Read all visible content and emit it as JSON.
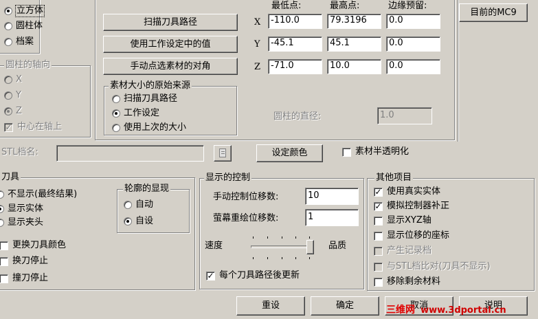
{
  "shape_group": {
    "options": [
      {
        "label": "立方体",
        "selected": true
      },
      {
        "label": "圆柱体",
        "selected": false
      },
      {
        "label": "档案",
        "selected": false
      }
    ]
  },
  "cylinder_axis": {
    "title": "圆柱的轴向",
    "options": [
      {
        "label": "X",
        "selected": false
      },
      {
        "label": "Y",
        "selected": false
      },
      {
        "label": "Z",
        "selected": true
      }
    ],
    "center_on_axis": {
      "label": "中心在轴上",
      "checked": true
    }
  },
  "bounds": {
    "buttons": {
      "scan_toolpath": "扫描刀具路径",
      "use_work_settings": "使用工作设定中的值",
      "pick_corners": "手动点选素材的对角"
    },
    "headers": {
      "min": "最低点:",
      "max": "最高点:",
      "margin": "边缘预留:"
    },
    "rows": [
      {
        "axis": "X",
        "min": "-110.0",
        "max": "79.3196",
        "margin": "0.0"
      },
      {
        "axis": "Y",
        "min": "-45.1",
        "max": "45.1",
        "margin": "0.0"
      },
      {
        "axis": "Z",
        "min": "-71.0",
        "max": "10.0",
        "margin": "0.0"
      }
    ],
    "cylinder_diameter_label": "圆柱的直径:",
    "cylinder_diameter_value": "1.0"
  },
  "source_group": {
    "title": "素材大小的原始来源",
    "options": [
      {
        "label": "扫描刀具路径",
        "selected": false
      },
      {
        "label": "工作设定",
        "selected": true
      },
      {
        "label": "使用上次的大小",
        "selected": false
      }
    ]
  },
  "current_mc9_button": "目前的MC9",
  "stl": {
    "label": "STL档名:",
    "value": "",
    "browse_icon": "browse-icon"
  },
  "set_color_button": "设定颜色",
  "translucent": {
    "label": "素材半透明化",
    "checked": false
  },
  "tool_group": {
    "title": "刀具",
    "display_options": [
      {
        "label": "不显示(最终结果)",
        "selected": false
      },
      {
        "label": "显示实体",
        "selected": true
      },
      {
        "label": "显示夹头",
        "selected": false
      }
    ],
    "checks": [
      {
        "label": "更换刀具颜色",
        "checked": false
      },
      {
        "label": "换刀停止",
        "checked": false
      },
      {
        "label": "撞刀停止",
        "checked": false
      }
    ]
  },
  "outline_group": {
    "title": "轮廓的显现",
    "options": [
      {
        "label": "自动",
        "selected": false
      },
      {
        "label": "自设",
        "selected": true
      }
    ]
  },
  "display_control": {
    "title": "显示的控制",
    "manual_steps_label": "手动控制位移数:",
    "manual_steps_value": "10",
    "redraw_steps_label": "萤幕重绘位移数:",
    "redraw_steps_value": "1",
    "speed_label": "速度",
    "quality_label": "品质",
    "slider_level": 1.0,
    "update_each_path": {
      "label": "每个刀具路径後更新",
      "checked": true
    }
  },
  "other_group": {
    "title": "其他项目",
    "items": [
      {
        "label": "使用真实实体",
        "checked": true,
        "enabled": true
      },
      {
        "label": "模拟控制器补正",
        "checked": true,
        "enabled": true
      },
      {
        "label": "显示XYZ轴",
        "checked": false,
        "enabled": true
      },
      {
        "label": "显示位移的座标",
        "checked": false,
        "enabled": true
      },
      {
        "label": "产生记录档",
        "checked": false,
        "enabled": false
      },
      {
        "label": "与STL档比对(刀具不显示)",
        "checked": false,
        "enabled": false
      },
      {
        "label": "移除剩余材料",
        "checked": false,
        "enabled": true
      }
    ]
  },
  "footer_buttons": {
    "reset": "重设",
    "ok": "确定",
    "cancel": "取消",
    "help": "说明"
  },
  "watermark": {
    "part1": "三维",
    "part2": "网",
    "part3": "www.3dportal.cn",
    "color1": "#e00000",
    "color2": "#d00000"
  }
}
